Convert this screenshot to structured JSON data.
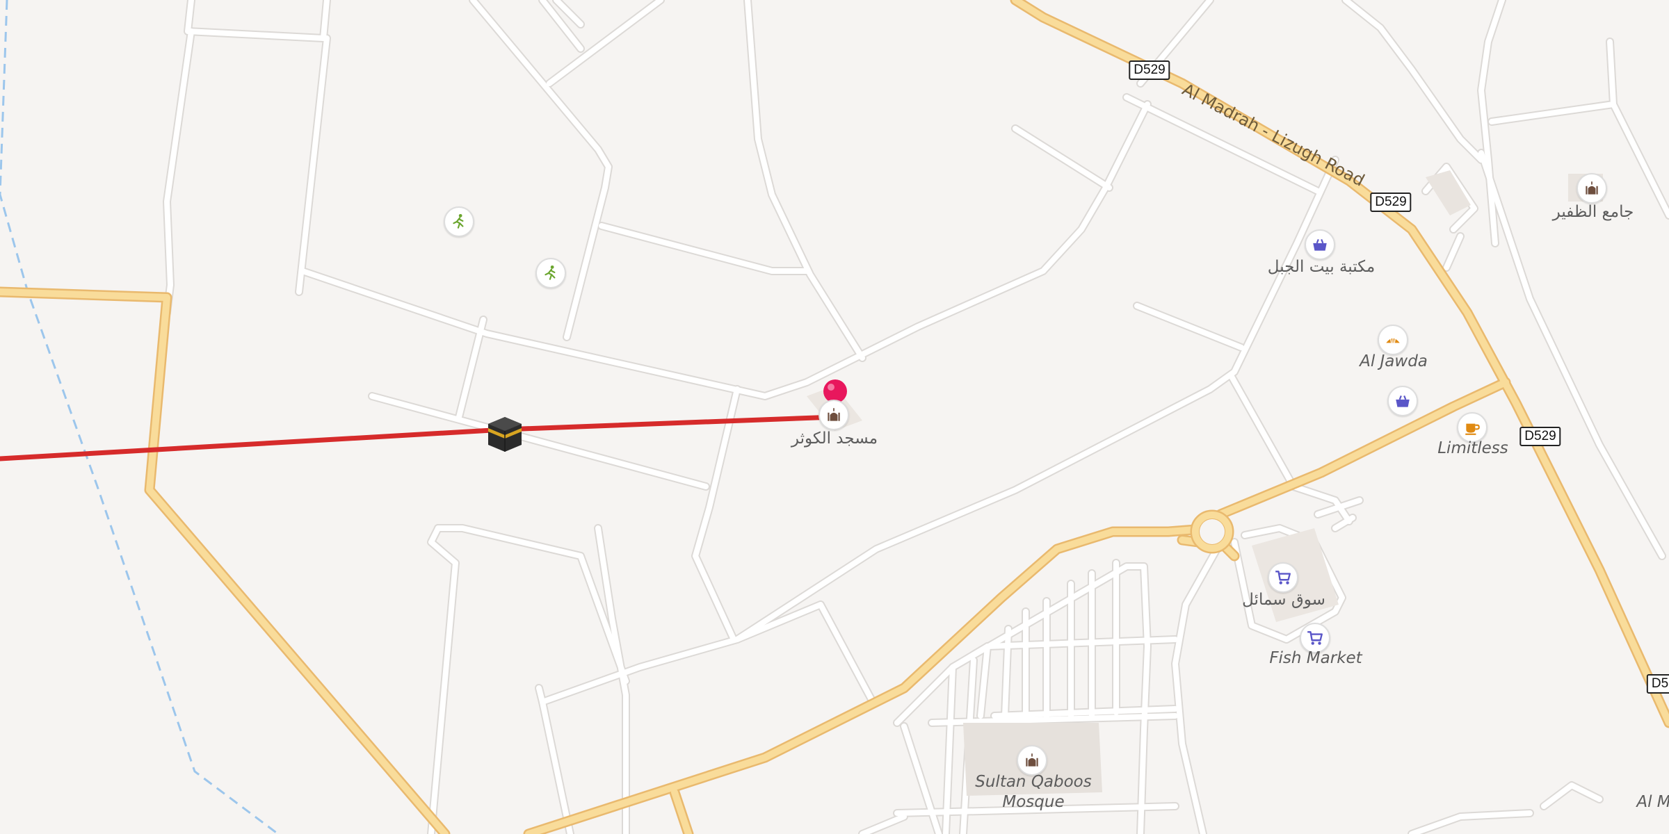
{
  "map": {
    "road_name": "Al Madrah - Lizugh Road",
    "route_shields": [
      {
        "id": "d529-1",
        "text": "D529"
      },
      {
        "id": "d529-2",
        "text": "D529"
      },
      {
        "id": "d529-3",
        "text": "D529"
      },
      {
        "id": "d5-edge",
        "text": "D5"
      }
    ],
    "places": [
      {
        "id": "masjid-alkawthar",
        "text": "مسجد الكوثر"
      },
      {
        "id": "maktaba",
        "text": "مكتبة بيت الجبل"
      },
      {
        "id": "jame-alzafir",
        "text": "جامع الظفير"
      },
      {
        "id": "al-jawda",
        "text": "Al Jawda"
      },
      {
        "id": "limitless",
        "text": "Limitless"
      },
      {
        "id": "souq-smail",
        "text": "سوق سمائل"
      },
      {
        "id": "fish-market",
        "text": "Fish Market"
      },
      {
        "id": "sultan-qaboos-1",
        "text": "Sultan Qaboos"
      },
      {
        "id": "sultan-qaboos-2",
        "text": "Mosque"
      },
      {
        "id": "al-m-edge",
        "text": "Al M"
      }
    ],
    "icons": {
      "mosque": "mosque-icon",
      "shop": "shopping-basket-icon",
      "cart": "shopping-cart-icon",
      "cafe": "cafe-icon",
      "bakery": "bakery-icon",
      "sport": "sports-icon",
      "marker": "location-pin-icon",
      "kaaba": "kaaba-icon"
    },
    "colors": {
      "background": "#f6f4f2",
      "minor_road": "#ffffff",
      "major_road": "#f9dc9a",
      "major_road_border": "#e9b96e",
      "route_line": "#d62b2b",
      "pin": "#e8175d",
      "water_dash": "#9cc6ec"
    }
  }
}
